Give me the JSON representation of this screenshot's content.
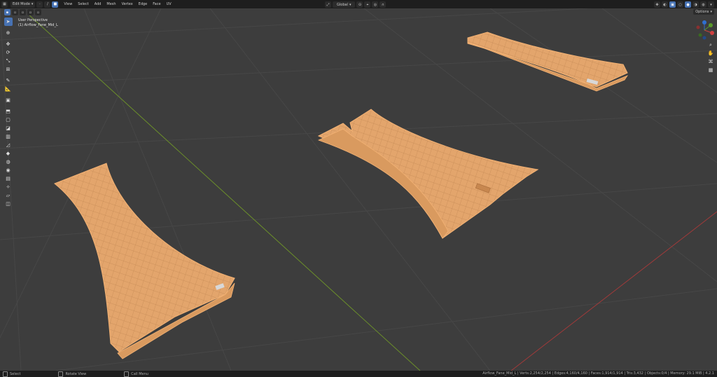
{
  "header": {
    "editor_icon": "3d-viewport-icon",
    "mode": "Edit Mode",
    "menus": [
      "View",
      "Select",
      "Add",
      "Mesh",
      "Vertex",
      "Edge",
      "Face",
      "UV"
    ],
    "transform_orientation": "Global",
    "options_label": "Options"
  },
  "viewport": {
    "view_name": "User Perspective",
    "object_label": "(1) Airflow_Fane_Mid_L"
  },
  "toolbar": {
    "tools": [
      "select-box-icon",
      "cursor-icon",
      "move-icon",
      "rotate-icon",
      "scale-icon",
      "transform-icon",
      "annotate-icon",
      "measure-icon",
      "add-cube-icon",
      "extrude-icon",
      "inset-icon",
      "bevel-icon",
      "loop-cut-icon",
      "knife-icon",
      "poly-build-icon",
      "spin-icon",
      "smooth-icon",
      "edge-slide-icon",
      "shrink-fatten-icon",
      "shear-icon",
      "rip-icon"
    ]
  },
  "status": {
    "hint1": "Select",
    "hint2": "Rotate View",
    "hint3": "Call Menu",
    "stats": "Airflow_Fane_Mid_L | Verts:2,254/2,254 | Edges:4,160/4,160 | Faces:1,914/1,914 | Tris:3,432 | Objects:0/4 | Memory: 29.1 MiB | 4.2.1"
  },
  "colors": {
    "viewport_bg": "#3d3d3d",
    "mesh_face": "#e9a86b",
    "mesh_edge": "#f0b070",
    "grid_line": "#4a4a4a",
    "x_axis": "#a03a3a",
    "y_axis": "#6b8f2a",
    "accent": "#4772b3"
  }
}
